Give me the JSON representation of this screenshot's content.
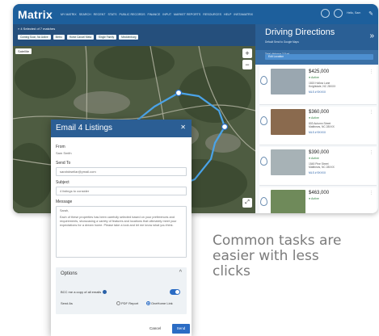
{
  "app": {
    "brand": "Matrix",
    "nav": [
      "MY MATRIX",
      "SEARCH",
      "RECENT",
      "STATS",
      "PUBLIC RECORDS",
      "FINANCE",
      "INPUT",
      "MARKET REPORTS",
      "RESOURCES",
      "HELP",
      "INSTAMATRIX"
    ],
    "user": "Hello, Sam"
  },
  "toolbar": {
    "selected": "4 Selected of 7 matches",
    "chips": [
      "Coming Soon, No Active",
      "Metro",
      "Home Cancel Meta",
      "Single Family",
      "Mecklenburg"
    ]
  },
  "map": {
    "type_label": "Satellite"
  },
  "directions": {
    "title": "Driving Directions",
    "radios": "Default   Send to Google Maps",
    "info": "Total distance 3.5 mi\nExtimated drive time: 8 mins",
    "edit_label": "Edit Location"
  },
  "listings": [
    {
      "price": "$425,000",
      "status": "Active",
      "address": "1815 Hollow Lane\nKnightdale, NC 28XXX",
      "mls": "MLS # 9XXXX",
      "photo_color": "#9aa7b0"
    },
    {
      "price": "$360,000",
      "status": "Active",
      "address": "803 Autumn Street\nMatthews, NC 28XXX",
      "mls": "MLS # 9XXXX",
      "photo_color": "#8a6a4e"
    },
    {
      "price": "$390,000",
      "status": "Active",
      "address": "1545 Pine Street\nMatthews, NC 28XXX",
      "mls": "MLS # 9XXXX",
      "photo_color": "#a7b2b6"
    },
    {
      "price": "$463,000",
      "status": "Active",
      "address": "",
      "mls": "",
      "photo_color": "#6f8a5a"
    }
  ],
  "email": {
    "title": "Email 4 Listings",
    "from_label": "From",
    "from_value": "Sam Smith",
    "sendto_label": "Send To",
    "sendto_value": "sarahdwellar@ymail.com",
    "subject_label": "Subject",
    "subject_value": "4 listings to consider",
    "message_label": "Message",
    "message_greeting": "Sarah,",
    "message_body": "Each of these properties has been carefully selected based on your preferences and requirements, showcasing a variety of features and locations that ultimately meet your expectations for a dream home. Please take a look and let me know what you think.",
    "options_title": "Options",
    "bcc_label": "BCC me a copy of all emails",
    "send_as_label": "Send As",
    "pdf_option": "PDF Report",
    "onehome_option": "OneHome Link",
    "cancel_label": "Cancel",
    "send_label": "Send"
  },
  "tagline": "Common tasks are easier with less clicks"
}
